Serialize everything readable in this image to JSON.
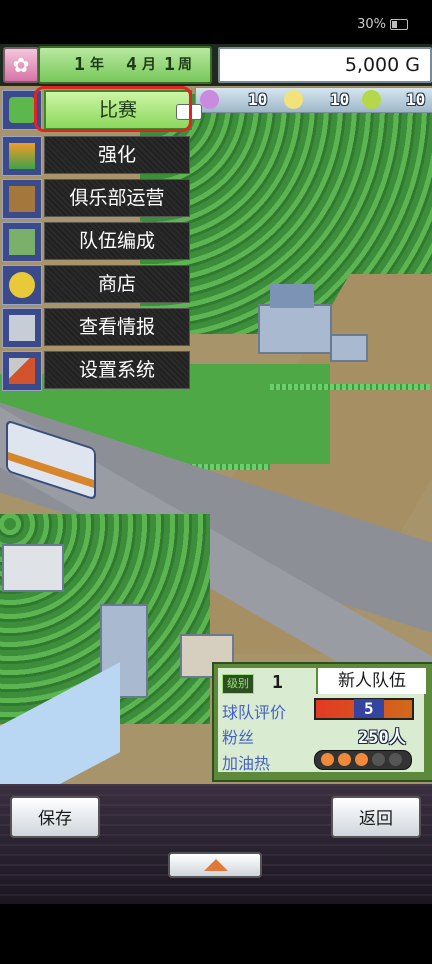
{
  "status_bar": {
    "battery_percent": "30%"
  },
  "header": {
    "year_num": "1",
    "year_unit": "年",
    "month_num": "4",
    "month_unit": "月",
    "week_num": "1",
    "week_unit": "周",
    "money": "5,000 G"
  },
  "stats": [
    {
      "icon": "heart-icon",
      "value": "10",
      "color": "#c98adf"
    },
    {
      "icon": "lightbulb-icon",
      "value": "10",
      "color": "#f1e37a"
    },
    {
      "icon": "coin-icon",
      "value": "10",
      "color": "#b5d84a"
    }
  ],
  "menu": {
    "items": [
      {
        "label": "比赛",
        "icon": "match-icon",
        "active": true
      },
      {
        "label": "强化",
        "icon": "upgrade-icon"
      },
      {
        "label": "俱乐部运营",
        "icon": "club-icon"
      },
      {
        "label": "队伍编成",
        "icon": "team-icon"
      },
      {
        "label": "商店",
        "icon": "shop-icon"
      },
      {
        "label": "查看情报",
        "icon": "info-icon"
      },
      {
        "label": "设置系统",
        "icon": "settings-icon"
      }
    ]
  },
  "team_panel": {
    "level_badge": "级别",
    "level": "1",
    "team_name": "新人队伍",
    "rating_label": "球队评价",
    "rating": "5",
    "fans_label": "粉丝",
    "fans": "250人",
    "cheer_label": "加油热",
    "cheer_level": 3,
    "cheer_max": 5
  },
  "bottom": {
    "save_label": "保存",
    "back_label": "返回"
  },
  "colors": {
    "accent_green": "#8cd85e",
    "highlight_red": "#e02424"
  }
}
